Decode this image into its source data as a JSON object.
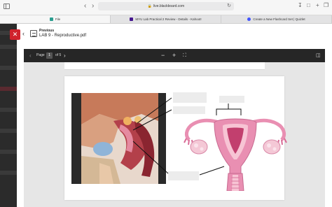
{
  "browser": {
    "url": "live.blackboard.com",
    "tabs": [
      {
        "label": "File",
        "color": "#2a9d8f"
      },
      {
        "label": "MYU Lab Practical 2 Review - Details - Kahoot!",
        "color": "#46178f"
      },
      {
        "label": "Create a New Flashcard Set | Quizlet",
        "color": "#4255ff"
      }
    ]
  },
  "header": {
    "previous_label": "Previous",
    "document_title": "LAB 9 - Reproductive.pdf"
  },
  "pdf_toolbar": {
    "page_label": "Page",
    "current_page": "1",
    "page_total": "of 5",
    "zoom_out": "−",
    "zoom_in": "+"
  },
  "colors": {
    "close_button": "#d0222c",
    "toolbar_bg": "#262626",
    "uterus_pink": "#e98fb2"
  }
}
